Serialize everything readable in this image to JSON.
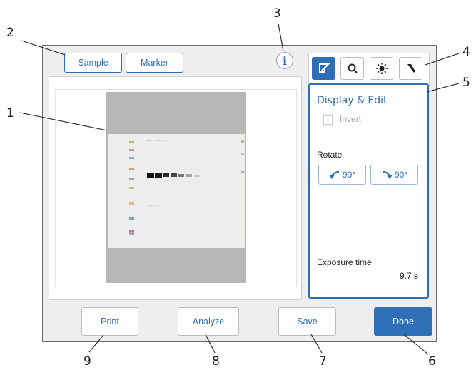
{
  "callouts": [
    "1",
    "2",
    "3",
    "4",
    "5",
    "6",
    "7",
    "8",
    "9"
  ],
  "header": {
    "sample_tab": "Sample",
    "marker_tab": "Marker",
    "info_glyph": "i"
  },
  "tools": [
    {
      "icon": "edit-icon",
      "active": true
    },
    {
      "icon": "zoom-icon",
      "active": false
    },
    {
      "icon": "brightness-icon",
      "active": false
    },
    {
      "icon": "marker-pen-icon",
      "active": false
    }
  ],
  "panel": {
    "title": "Display & Edit",
    "invert_label": "Invert",
    "rotate_label": "Rotate",
    "rotate_left_label": "90°",
    "rotate_right_label": "90°",
    "exposure_label": "Exposure time",
    "exposure_value": "9.7 s"
  },
  "buttons": {
    "print": "Print",
    "analyze": "Analyze",
    "save": "Save",
    "done": "Done"
  },
  "colors": {
    "accent": "#2f6fb7",
    "frame": "#eeeeee",
    "membrane": "#b7b7b7"
  }
}
